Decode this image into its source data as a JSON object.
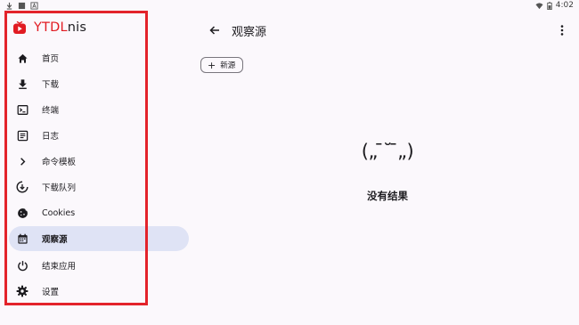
{
  "status_bar": {
    "time": "4:02",
    "left_icons": [
      "download-icon",
      "sim-icon",
      "font-icon"
    ],
    "right_icons": [
      "wifi-icon",
      "battery-icon"
    ]
  },
  "sidebar": {
    "brand": {
      "prefix": "YTDL",
      "suffix": "nis",
      "logo_color": "#e11b22"
    },
    "items": [
      {
        "label": "首页",
        "icon": "home-icon"
      },
      {
        "label": "下载",
        "icon": "download-icon"
      },
      {
        "label": "终端",
        "icon": "terminal-icon"
      },
      {
        "label": "日志",
        "icon": "log-icon"
      },
      {
        "label": "命令模板",
        "icon": "chevron-right-icon"
      },
      {
        "label": "下载队列",
        "icon": "download-queue-icon"
      },
      {
        "label": "Cookies",
        "icon": "cookie-icon"
      },
      {
        "label": "观察源",
        "icon": "calendar-icon",
        "active": true
      },
      {
        "label": "结束应用",
        "icon": "power-icon"
      },
      {
        "label": "设置",
        "icon": "gear-icon"
      }
    ]
  },
  "header": {
    "title": "观察源"
  },
  "toolbar": {
    "new_label": "新源"
  },
  "empty_state": {
    "face": "(„ ̄˘ ̄„)",
    "message": "没有结果"
  },
  "colors": {
    "accent": "#e11b22",
    "active_bg": "#dfe3f5",
    "highlight_border": "#e3232b",
    "background": "#fbf8fc"
  }
}
